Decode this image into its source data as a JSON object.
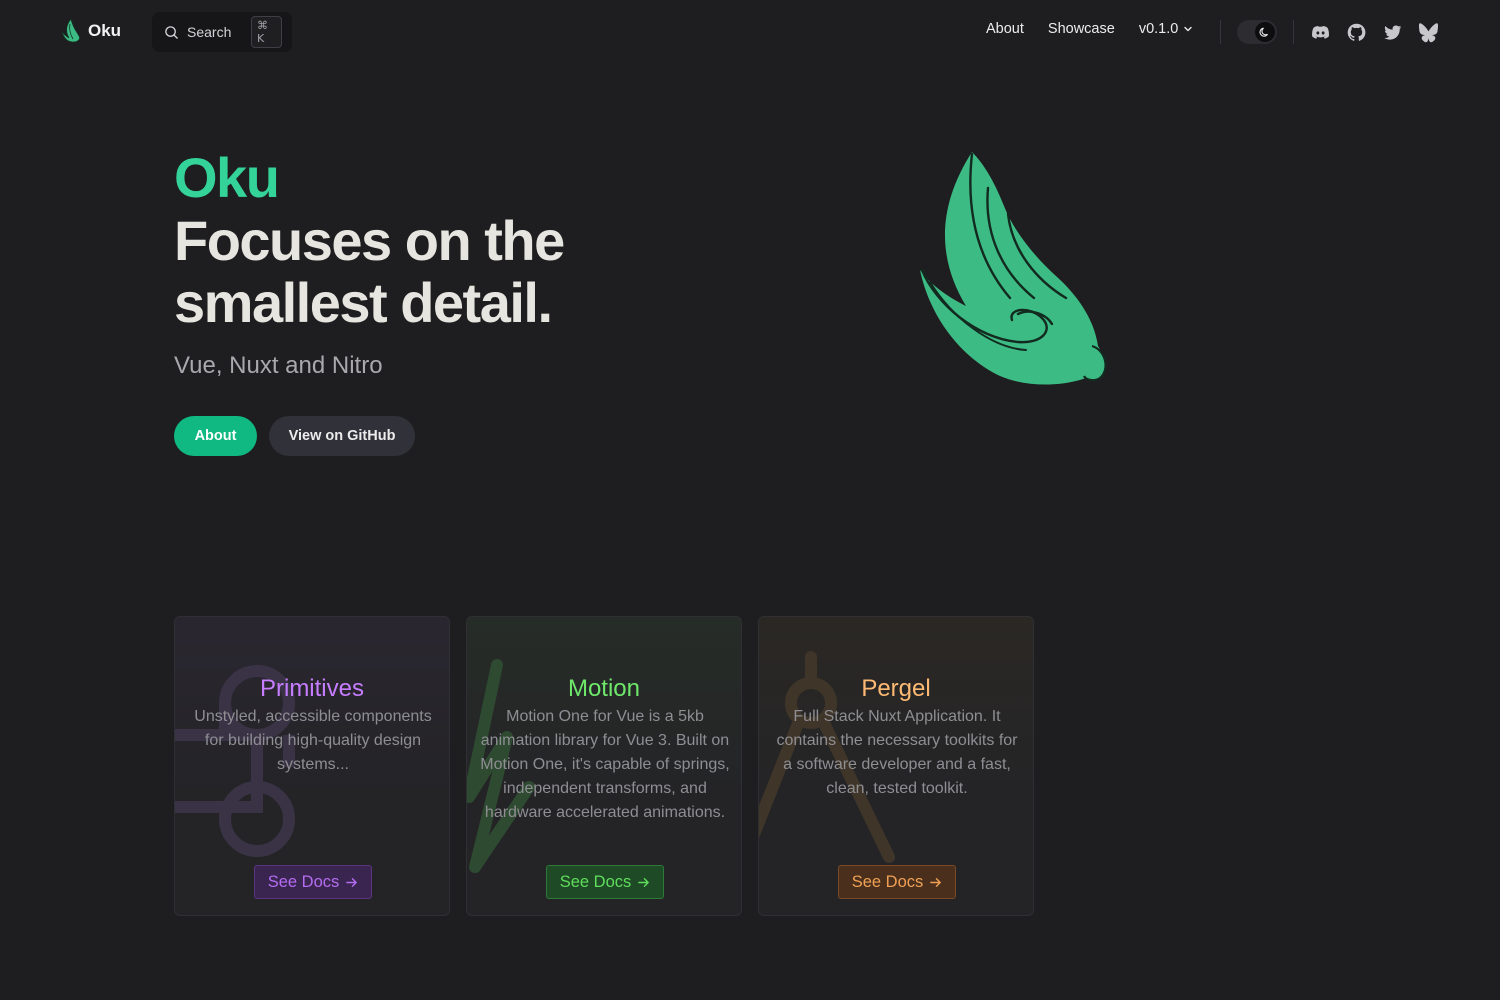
{
  "nav": {
    "brand": "Oku",
    "search": {
      "placeholder": "Search",
      "shortcut": "⌘ K"
    },
    "links": {
      "about": "About",
      "showcase": "Showcase"
    },
    "version": "v0.1.0",
    "theme": "dark",
    "social": [
      "discord-icon",
      "github-icon",
      "twitter-icon",
      "bluesky-icon"
    ]
  },
  "hero": {
    "brand": "Oku",
    "title": "Focuses on the smallest detail.",
    "subtitle": "Vue, Nuxt and Nitro",
    "primary_button": "About",
    "secondary_button": "View on GitHub"
  },
  "cards": [
    {
      "title": "Primitives",
      "description": "Unstyled, accessible components for building high‑quality design systems...",
      "button": "See Docs",
      "accent": "#c77dff"
    },
    {
      "title": "Motion",
      "description": "Motion One for Vue is a 5kb animation library for Vue 3. Built on Motion One, it's capable of springs, independent transforms, and hardware accelerated animations.",
      "button": "See Docs",
      "accent": "#6ee76a"
    },
    {
      "title": "Pergel",
      "description": "Full Stack Nuxt Application. It contains the necessary toolkits for a software developer and a fast, clean, tested toolkit.",
      "button": "See Docs",
      "accent": "#fdba74"
    }
  ],
  "colors": {
    "background": "#1e1e20",
    "brand_green": "#34d399",
    "button_green": "#10b981"
  }
}
